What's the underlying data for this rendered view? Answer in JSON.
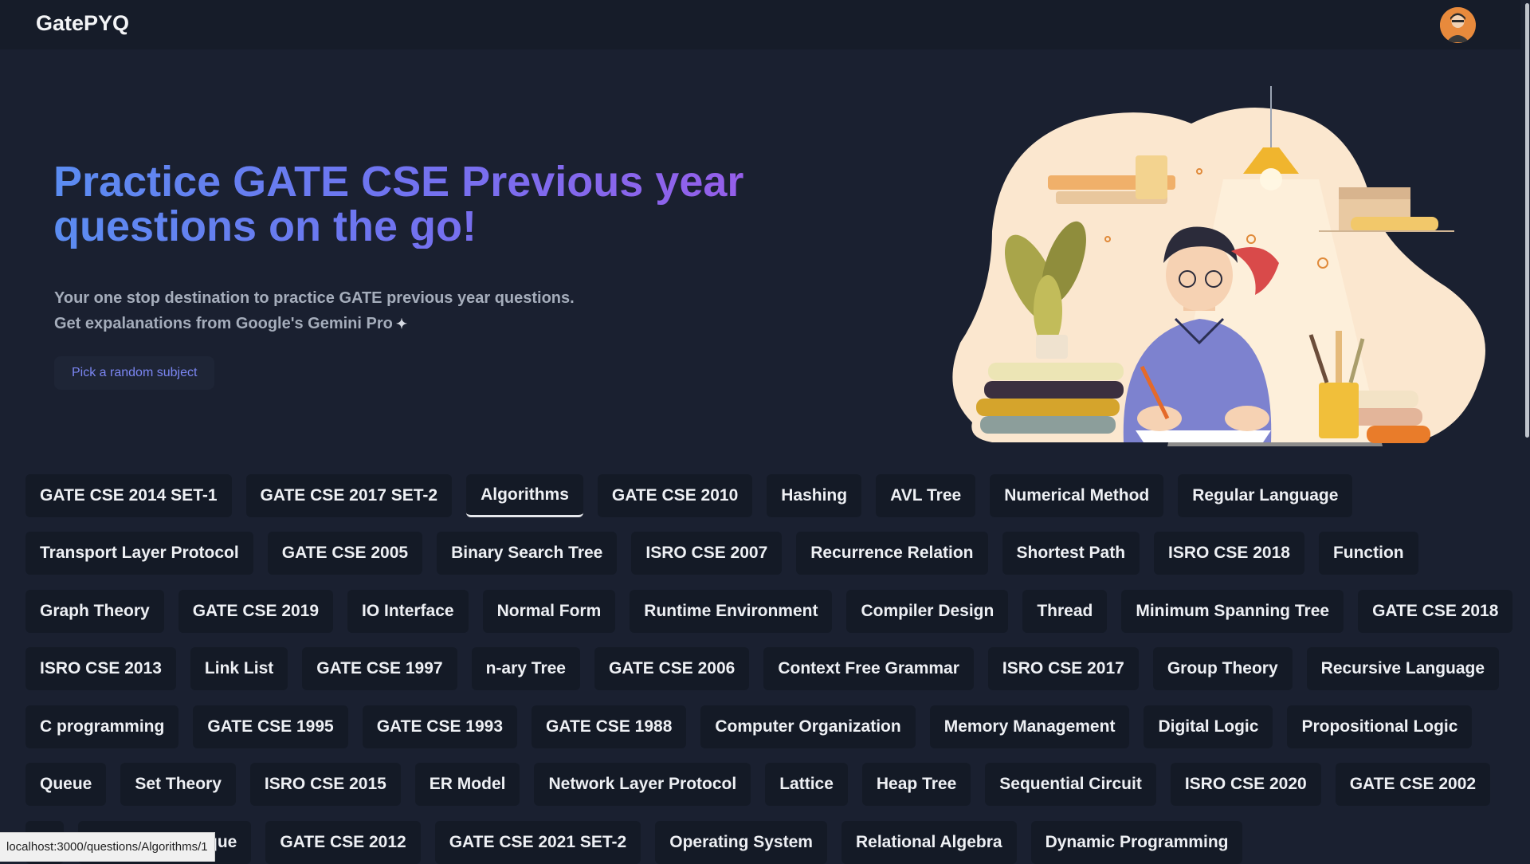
{
  "navbar": {
    "brand": "GatePYQ",
    "avatar_icon": "user-avatar-icon"
  },
  "hero": {
    "title": "Practice GATE CSE Previous year questions on the go!",
    "subtitle_line1": "Your one stop destination to practice GATE previous year questions.",
    "subtitle_line2": "Get expalanations from Google's Gemini Pro",
    "sparkle_icon": "✦",
    "random_button": "Pick a random subject"
  },
  "tags": {
    "rows": [
      [
        "GATE CSE 2014 SET-1",
        "GATE CSE 2017 SET-2",
        "Algorithms",
        "GATE CSE 2010",
        "Hashing",
        "AVL Tree",
        "Numerical Method",
        "Regular Language"
      ],
      [
        "Transport Layer Protocol",
        "GATE CSE 2005",
        "Binary Search Tree",
        "ISRO CSE 2007",
        "Recurrence Relation",
        "Shortest Path",
        "ISRO CSE 2018",
        "Function"
      ],
      [
        "Graph Theory",
        "GATE CSE 2019",
        "IO Interface",
        "Normal Form",
        "Runtime Environment",
        "Compiler Design",
        "Thread",
        "Minimum Spanning Tree",
        "GATE CSE 2018"
      ],
      [
        "ISRO CSE 2013",
        "Link List",
        "GATE CSE 1997",
        "n-ary Tree",
        "GATE CSE 2006",
        "Context Free Grammar",
        "ISRO CSE 2017",
        "Group Theory",
        "Recursive Language"
      ],
      [
        "C programming",
        "GATE CSE 1995",
        "GATE CSE 1993",
        "GATE CSE 1988",
        "Computer Organization",
        "Memory Management",
        "Digital Logic",
        "Propositional Logic"
      ],
      [
        "Queue",
        "Set Theory",
        "ISRO CSE 2015",
        "ER Model",
        "Network Layer Protocol",
        "Lattice",
        "Heap Tree",
        "Sequential Circuit",
        "ISRO CSE 2020",
        "GATE CSE 2002"
      ],
      [
        "e",
        "Greedy Technique",
        "GATE CSE 2012",
        "GATE CSE 2021 SET-2",
        "Operating System",
        "Relational Algebra",
        "Dynamic Programming"
      ]
    ],
    "active": "Algorithms"
  },
  "status_url": "localhost:3000/questions/Algorithms/1"
}
